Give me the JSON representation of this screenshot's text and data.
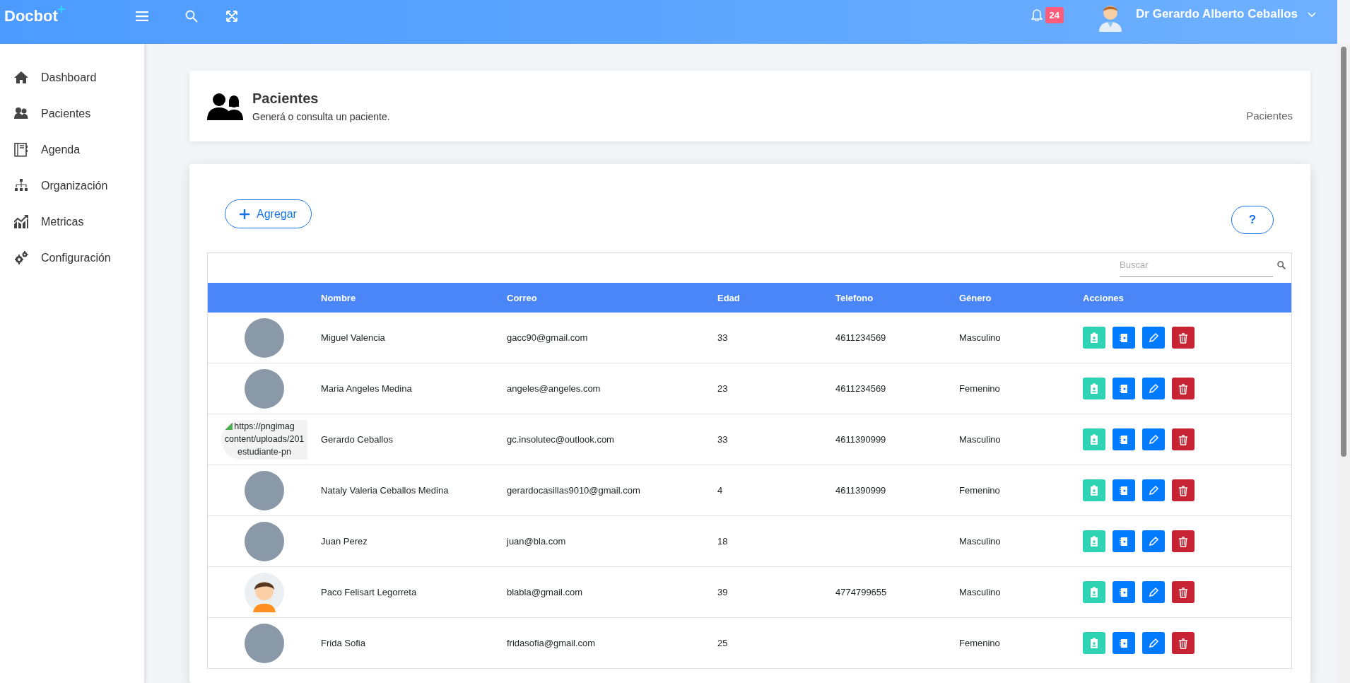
{
  "header": {
    "logo": "Docbot",
    "notification_count": "24",
    "user_name": "Dr Gerardo Alberto Ceballos"
  },
  "sidebar": {
    "items": [
      {
        "label": "Dashboard",
        "kind": "home",
        "selected": false
      },
      {
        "label": "Pacientes",
        "kind": "users",
        "selected": false
      },
      {
        "label": "Agenda",
        "kind": "book",
        "selected": false
      },
      {
        "label": "Organización",
        "kind": "org",
        "selected": false
      },
      {
        "label": "Metricas",
        "kind": "chart",
        "selected": false
      },
      {
        "label": "Configuración",
        "kind": "gears",
        "selected": false
      }
    ]
  },
  "page_header": {
    "title": "Pacientes",
    "subtitle": "Generá o consulta un paciente.",
    "breadcrumb": "Pacientes"
  },
  "toolbar": {
    "add_button": "Agregar",
    "help_button": "?"
  },
  "search": {
    "placeholder": "Buscar"
  },
  "table": {
    "columns": [
      "Nombre",
      "Correo",
      "Edad",
      "Telefono",
      "Género",
      "Acciones"
    ],
    "rows": [
      {
        "avatar": {
          "kind": "photo"
        },
        "cells": [
          "Miguel Valencia",
          "gacc90@gmail.com",
          "33",
          "4611234569",
          "Masculino"
        ]
      },
      {
        "avatar": {
          "kind": "photo"
        },
        "cells": [
          "Maria Angeles Medina",
          "angeles@angeles.com",
          "23",
          "4611234569",
          "Femenino"
        ]
      },
      {
        "avatar": {
          "kind": "broken",
          "alt_lines": [
            "https://pngimag",
            "content/uploads/201",
            "estudiante-pn"
          ]
        },
        "cells": [
          "Gerardo Ceballos",
          "gc.insolutec@outlook.com",
          "33",
          "4611390999",
          "Masculino"
        ]
      },
      {
        "avatar": {
          "kind": "photo"
        },
        "cells": [
          "Nataly Valeria Ceballos Medina",
          "gerardocasillas9010@gmail.com",
          "4",
          "4611390999",
          "Femenino"
        ]
      },
      {
        "avatar": {
          "kind": "photo"
        },
        "cells": [
          "Juan Perez",
          "juan@bla.com",
          "18",
          "",
          "Masculino"
        ]
      },
      {
        "avatar": {
          "kind": "cartoon"
        },
        "cells": [
          "Paco Felisart Legorreta",
          "blabla@gmail.com",
          "39",
          "4774799655",
          "Masculino"
        ]
      },
      {
        "avatar": {
          "kind": "photo"
        },
        "cells": [
          "Frida Sofia",
          "fridasofia@gmail.com",
          "25",
          "",
          "Femenino"
        ]
      }
    ]
  }
}
